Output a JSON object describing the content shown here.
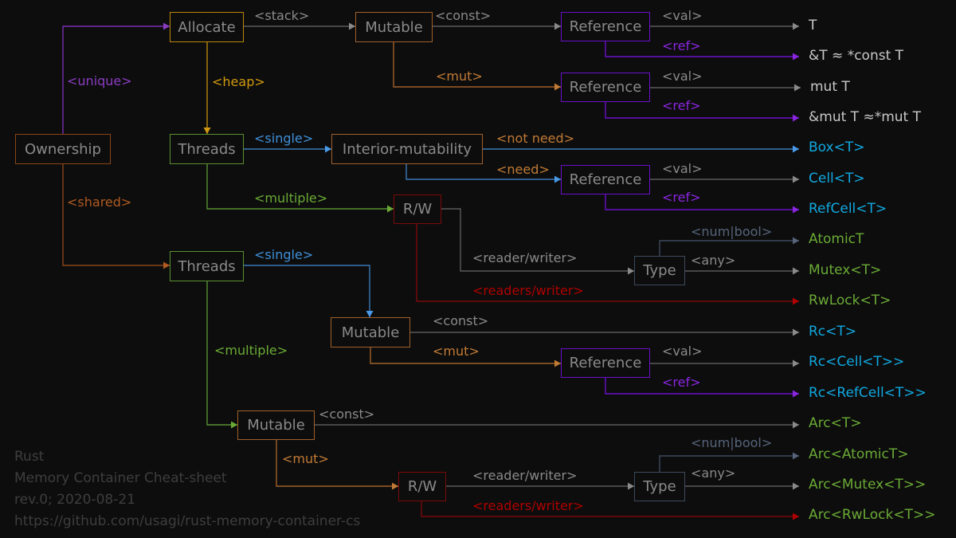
{
  "colors": {
    "background": "#0d0d0d",
    "box_text": "#8a8a8a",
    "gray": "#5a5a5a",
    "gray_text": "#8a8a8a",
    "purple": "#7a2fb0",
    "violet": "#6a10c8",
    "violet_text": "#8a25e0",
    "gold": "#b8860b",
    "gold_text": "#d19a10",
    "orange": "#a0602a",
    "orange_text": "#c07a35",
    "brown": "#8a4518",
    "brown_text": "#b05a20",
    "green": "#5a9030",
    "green_text": "#6aaa35",
    "blue": "#3a78b8",
    "blue_text": "#3f8fd8",
    "red": "#7a0a0a",
    "red_text": "#b00000",
    "slate": "#3c4a5c",
    "slate_text": "#56647a",
    "cyan_text": "#10a8e0",
    "white_text": "#c8c8c8"
  },
  "nodes": {
    "ownership": "Ownership",
    "allocate": "Allocate",
    "mutable_stack": "Mutable",
    "ref_const": "Reference",
    "ref_mut": "Reference",
    "threads_unique": "Threads",
    "interior": "Interior-mutability",
    "ref_interior": "Reference",
    "rw_unique": "R/W",
    "type_unique": "Type",
    "threads_shared": "Threads",
    "mutable_rc": "Mutable",
    "ref_rc": "Reference",
    "mutable_arc": "Mutable",
    "rw_arc": "R/W",
    "type_arc": "Type"
  },
  "labels": {
    "unique": "<unique>",
    "shared": "<shared>",
    "stack": "<stack>",
    "heap": "<heap>",
    "const_1": "<const>",
    "mut_1": "<mut>",
    "val_1": "<val>",
    "ref_1": "<ref>",
    "val_2": "<val>",
    "ref_2": "<ref>",
    "single_1": "<single>",
    "multiple_1": "<multiple>",
    "not_need": "<not need>",
    "need": "<need>",
    "val_3": "<val>",
    "ref_3": "<ref>",
    "reader_writer_1": "<reader/writer>",
    "readers_writer_1": "<readers/writer>",
    "num_bool_1": "<num|bool>",
    "any_1": "<any>",
    "single_2": "<single>",
    "multiple_2": "<multiple>",
    "const_2": "<const>",
    "mut_2": "<mut>",
    "val_4": "<val>",
    "ref_4": "<ref>",
    "const_3": "<const>",
    "mut_3": "<mut>",
    "reader_writer_2": "<reader/writer>",
    "readers_writer_2": "<readers/writer>",
    "num_bool_2": "<num|bool>",
    "any_2": "<any>"
  },
  "outputs": {
    "t": "T",
    "ref_t": "&T ≈ *const T",
    "mut_t": "mut T",
    "ref_mut_t": "&mut T ≈*mut T",
    "box": "Box<T>",
    "cell": "Cell<T>",
    "refcell": "RefCell<T>",
    "atomic": "AtomicT",
    "mutex": "Mutex<T>",
    "rwlock": "RwLock<T>",
    "rc": "Rc<T>",
    "rc_cell": "Rc<Cell<T>>",
    "rc_refcell": "Rc<RefCell<T>>",
    "arc": "Arc<T>",
    "arc_atomic": "Arc<AtomicT>",
    "arc_mutex": "Arc<Mutex<T>>",
    "arc_rwlock": "Arc<RwLock<T>>"
  },
  "footer": {
    "line1": "Rust",
    "line2": "Memory Container Cheat-sheet",
    "line3": "rev.0; 2020-08-21",
    "line4": "https://github.com/usagi/rust-memory-container-cs"
  }
}
